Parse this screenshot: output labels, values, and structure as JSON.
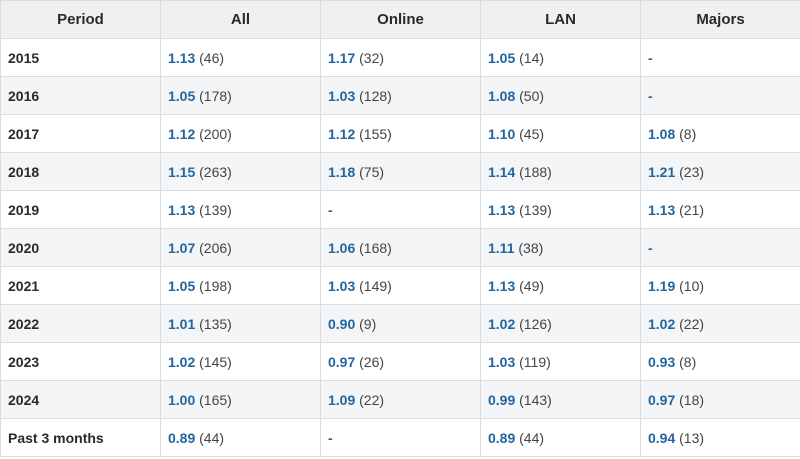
{
  "table": {
    "headers": [
      "Period",
      "All",
      "Online",
      "LAN",
      "Majors"
    ],
    "rows": [
      {
        "period": "2015",
        "cells": [
          {
            "rating": "1.13",
            "count": "(46)"
          },
          {
            "rating": "1.17",
            "count": "(32)"
          },
          {
            "rating": "1.05",
            "count": "(14)"
          },
          {
            "rating": "-",
            "count": ""
          }
        ]
      },
      {
        "period": "2016",
        "cells": [
          {
            "rating": "1.05",
            "count": "(178)"
          },
          {
            "rating": "1.03",
            "count": "(128)"
          },
          {
            "rating": "1.08",
            "count": "(50)"
          },
          {
            "rating": "-",
            "count": ""
          }
        ]
      },
      {
        "period": "2017",
        "cells": [
          {
            "rating": "1.12",
            "count": "(200)"
          },
          {
            "rating": "1.12",
            "count": "(155)"
          },
          {
            "rating": "1.10",
            "count": "(45)"
          },
          {
            "rating": "1.08",
            "count": "(8)"
          }
        ]
      },
      {
        "period": "2018",
        "cells": [
          {
            "rating": "1.15",
            "count": "(263)"
          },
          {
            "rating": "1.18",
            "count": "(75)"
          },
          {
            "rating": "1.14",
            "count": "(188)"
          },
          {
            "rating": "1.21",
            "count": "(23)"
          }
        ]
      },
      {
        "period": "2019",
        "cells": [
          {
            "rating": "1.13",
            "count": "(139)"
          },
          {
            "rating": "-",
            "count": ""
          },
          {
            "rating": "1.13",
            "count": "(139)"
          },
          {
            "rating": "1.13",
            "count": "(21)"
          }
        ]
      },
      {
        "period": "2020",
        "cells": [
          {
            "rating": "1.07",
            "count": "(206)"
          },
          {
            "rating": "1.06",
            "count": "(168)"
          },
          {
            "rating": "1.11",
            "count": "(38)"
          },
          {
            "rating": "-",
            "count": ""
          }
        ]
      },
      {
        "period": "2021",
        "cells": [
          {
            "rating": "1.05",
            "count": "(198)"
          },
          {
            "rating": "1.03",
            "count": "(149)"
          },
          {
            "rating": "1.13",
            "count": "(49)"
          },
          {
            "rating": "1.19",
            "count": "(10)"
          }
        ]
      },
      {
        "period": "2022",
        "cells": [
          {
            "rating": "1.01",
            "count": "(135)"
          },
          {
            "rating": "0.90",
            "count": "(9)"
          },
          {
            "rating": "1.02",
            "count": "(126)"
          },
          {
            "rating": "1.02",
            "count": "(22)"
          }
        ]
      },
      {
        "period": "2023",
        "cells": [
          {
            "rating": "1.02",
            "count": "(145)"
          },
          {
            "rating": "0.97",
            "count": "(26)"
          },
          {
            "rating": "1.03",
            "count": "(119)"
          },
          {
            "rating": "0.93",
            "count": "(8)"
          }
        ]
      },
      {
        "period": "2024",
        "cells": [
          {
            "rating": "1.00",
            "count": "(165)"
          },
          {
            "rating": "1.09",
            "count": "(22)"
          },
          {
            "rating": "0.99",
            "count": "(143)"
          },
          {
            "rating": "0.97",
            "count": "(18)"
          }
        ]
      },
      {
        "period": "Past 3 months",
        "cells": [
          {
            "rating": "0.89",
            "count": "(44)"
          },
          {
            "rating": "-",
            "count": ""
          },
          {
            "rating": "0.89",
            "count": "(44)"
          },
          {
            "rating": "0.94",
            "count": "(13)"
          }
        ]
      }
    ]
  },
  "colors": {
    "rating": "#23659f",
    "header_bg": "#eef0f2",
    "stripe_bg": "#f4f5f7",
    "border": "#d9dde1"
  }
}
